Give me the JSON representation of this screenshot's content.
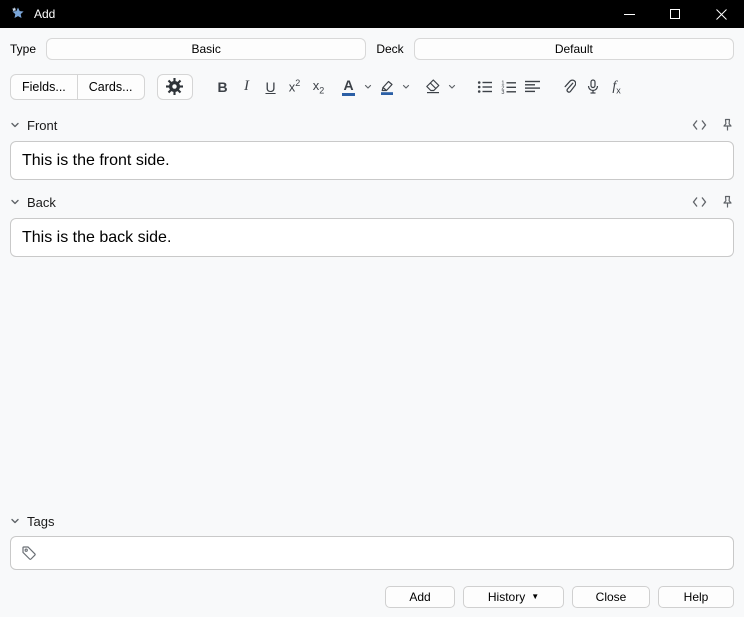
{
  "window": {
    "title": "Add"
  },
  "header": {
    "type_label": "Type",
    "type_value": "Basic",
    "deck_label": "Deck",
    "deck_value": "Default"
  },
  "toolbar": {
    "fields": "Fields...",
    "cards": "Cards...",
    "bold": "B",
    "italic": "I",
    "underline": "U",
    "superscript_base": "x",
    "superscript_exp": "2",
    "subscript_base": "x",
    "subscript_sub": "2",
    "text_color_letter": "A",
    "equation_f": "f",
    "equation_x": "x"
  },
  "fields": [
    {
      "label": "Front",
      "value": "This is the front side."
    },
    {
      "label": "Back",
      "value": "This is the back side."
    }
  ],
  "tags": {
    "label": "Tags",
    "value": ""
  },
  "footer": {
    "add": "Add",
    "history": "History",
    "history_arrow": "▼",
    "close": "Close",
    "help": "Help"
  },
  "colors": {
    "titlebar": "#000000",
    "window_background": "#f8f9fa",
    "accent_blue": "#2b5fa5"
  }
}
